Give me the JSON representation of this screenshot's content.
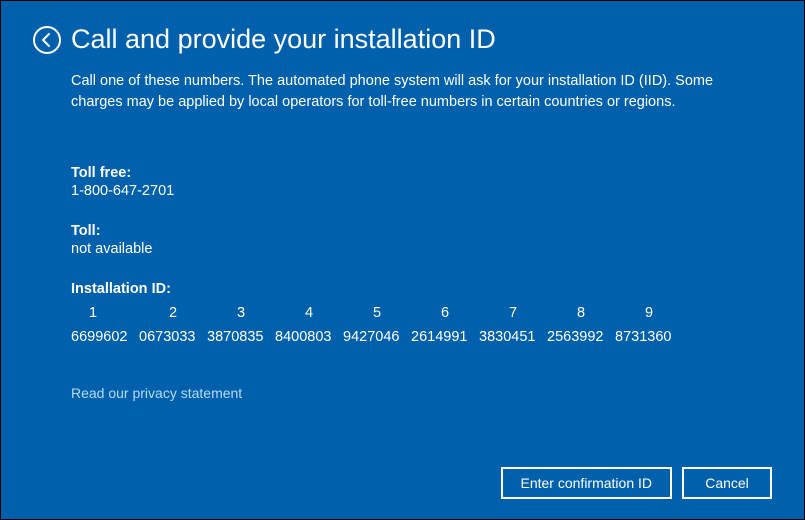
{
  "header": {
    "title": "Call and provide your installation ID"
  },
  "description": "Call one of these numbers. The automated phone system will ask for your installation ID (IID). Some charges may be applied by local operators for toll-free numbers in certain countries or regions.",
  "phone": {
    "tollfree_label": "Toll free:",
    "tollfree_value": "1-800-647-2701",
    "toll_label": "Toll:",
    "toll_value": "not available"
  },
  "iid": {
    "label": "Installation ID:",
    "columns": [
      "1",
      "2",
      "3",
      "4",
      "5",
      "6",
      "7",
      "8",
      "9"
    ],
    "groups": [
      "6699602",
      "0673033",
      "3870835",
      "8400803",
      "9427046",
      "2614991",
      "3830451",
      "2563992",
      "8731360"
    ]
  },
  "privacy_link": "Read our privacy statement",
  "buttons": {
    "enter_confirmation": "Enter confirmation ID",
    "cancel": "Cancel"
  }
}
